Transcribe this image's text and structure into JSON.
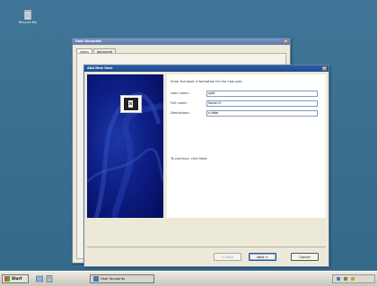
{
  "desktop": {
    "recycle_bin_label": "Recycle Bin"
  },
  "user_accounts": {
    "title": "User Accounts",
    "tabs": [
      {
        "label": "Users"
      },
      {
        "label": "Advanced"
      }
    ]
  },
  "add_new_user": {
    "title": "Add New User",
    "intro": "Enter the basic information for the new user.",
    "fields": [
      {
        "label": "User name:",
        "value": "sjolt"
      },
      {
        "label": "Full name:",
        "value": "Sonah S."
      },
      {
        "label": "Description:",
        "value": "s.lidda"
      }
    ],
    "hint": "To continue, click Next.",
    "buttons": {
      "back": "< Back",
      "next": "Next >",
      "cancel": "Cancel"
    }
  },
  "taskbar": {
    "start_label": "Start",
    "task_label": "User Accounts",
    "tray_icons": [
      "network-icon",
      "volume-icon",
      "security-icon"
    ]
  }
}
